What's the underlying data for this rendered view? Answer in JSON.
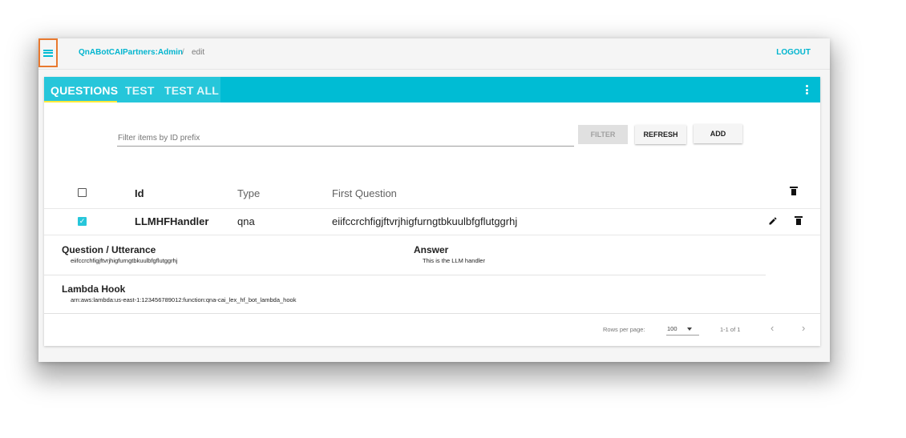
{
  "topbar": {
    "breadcrumb_link": "QnABotCAIPartners:Admin",
    "breadcrumb_sep": "/",
    "breadcrumb_current": "edit",
    "logout_label": "LOGOUT",
    "menu_icon": "hamburger-menu-icon"
  },
  "tabs": [
    {
      "label": "QUESTIONS",
      "active": true
    },
    {
      "label": "TEST",
      "active": false
    },
    {
      "label": "TEST ALL",
      "active": false
    }
  ],
  "toolbar": {
    "filter_placeholder": "Filter items by ID prefix",
    "filter_value": "",
    "filter_label": "FILTER",
    "refresh_label": "REFRESH",
    "add_label": "ADD"
  },
  "table": {
    "headers": {
      "id": "Id",
      "type": "Type",
      "first_question": "First Question"
    },
    "rows": [
      {
        "selected": true,
        "id": "LLMHFHandler",
        "type": "qna",
        "first_question": "eiifccrchfigjftvrjhigfurngtbkuulbfgflutggrhj"
      }
    ]
  },
  "detail": {
    "question_label": "Question / Utterance",
    "question_value": "eiifccrchfigjftvrjhigfurngtbkuulbfgflutggrhj",
    "answer_label": "Answer",
    "answer_value": "This is the LLM handler",
    "lambda_label": "Lambda Hook",
    "lambda_value": "arn:aws:lambda:us-east-1:123456789012:function:qna-cai_lex_hf_bot_lambda_hook"
  },
  "pagination": {
    "rows_per_page_label": "Rows per page:",
    "rows_per_page_value": "100",
    "range_text": "1-1 of 1",
    "prev_icon": "chevron-left-icon",
    "next_icon": "chevron-right-icon"
  },
  "colors": {
    "accent": "#00bcd4",
    "tab_underline": "#ffeb3b",
    "menu_highlight": "#e8792f"
  }
}
